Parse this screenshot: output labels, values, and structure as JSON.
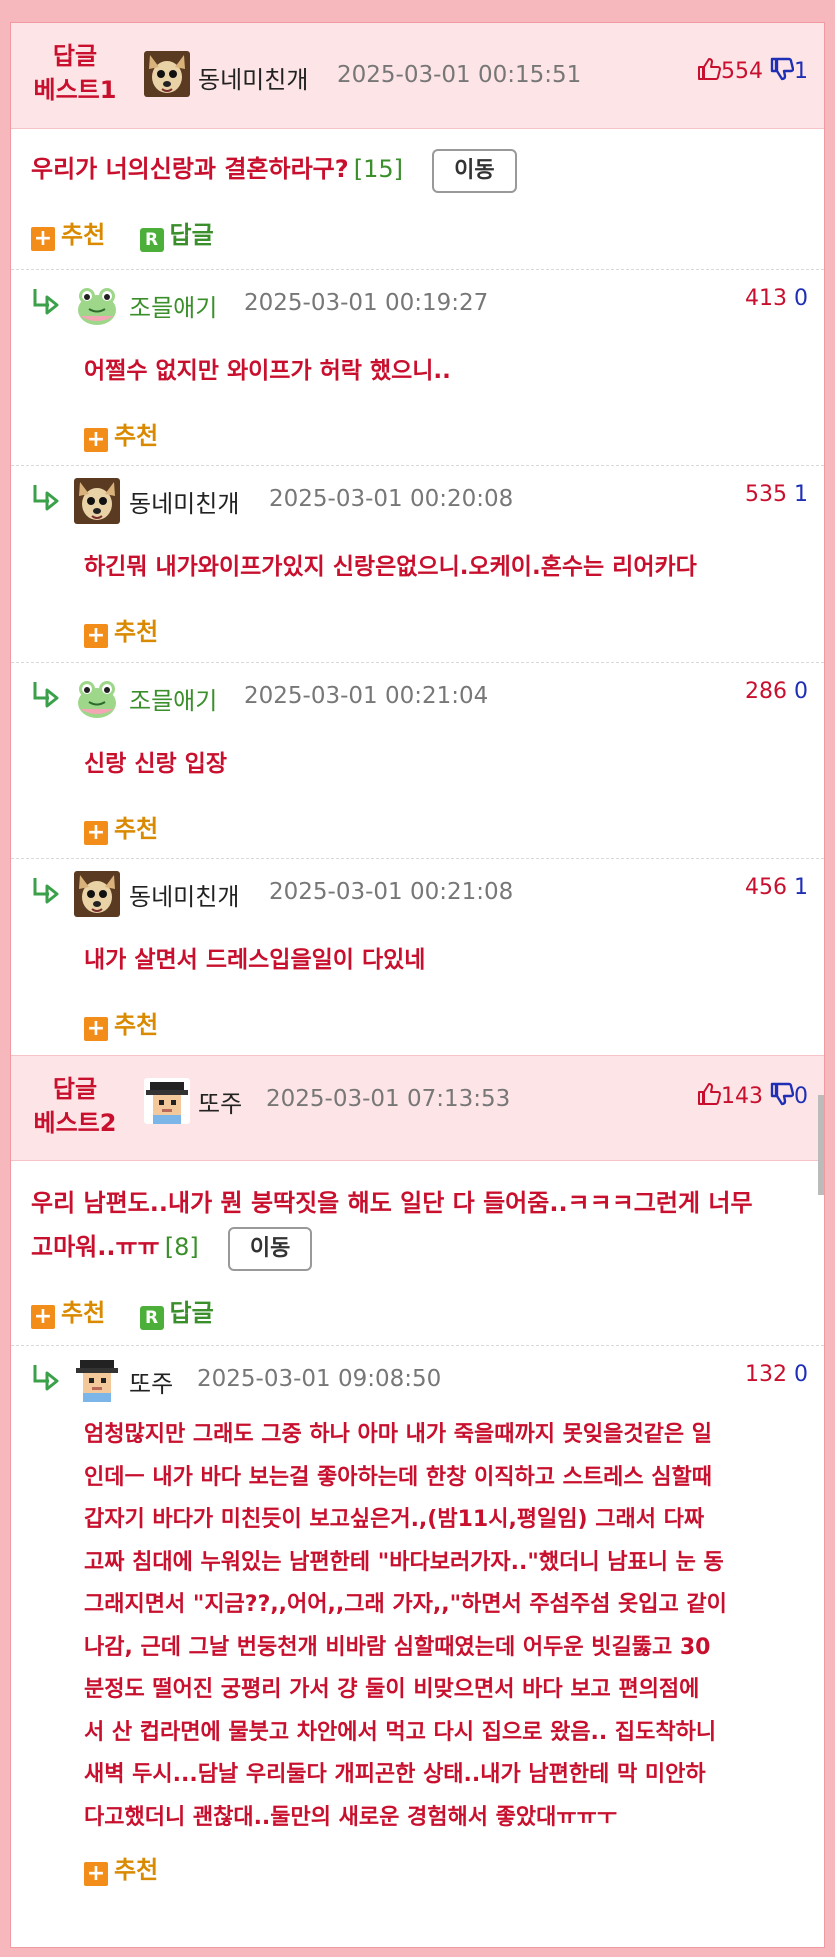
{
  "best": [
    {
      "label_line1": "답글",
      "label_line2": "베스트1",
      "nick": "동네미친개",
      "date": "2025-03-01 00:15:51",
      "up": "554",
      "down": "1",
      "title": "우리가 너의신랑과 결혼하라구?",
      "count": "[15]",
      "move": "이동",
      "recommend": "추천",
      "reply": "답글",
      "replies": [
        {
          "nick": "조믈애기",
          "date": "2025-03-01 00:19:27",
          "up": "413",
          "down": "0",
          "text": "어쩔수 없지만 와이프가 허락 했으니..",
          "recommend": "추천"
        },
        {
          "nick": "동네미친개",
          "date": "2025-03-01 00:20:08",
          "up": "535",
          "down": "1",
          "text": "하긴뭐 내가와이프가있지 신랑은없으니.오케이.혼수는 리어카다",
          "recommend": "추천"
        },
        {
          "nick": "조믈애기",
          "date": "2025-03-01 00:21:04",
          "up": "286",
          "down": "0",
          "text": "신랑 신랑 입장",
          "recommend": "추천"
        },
        {
          "nick": "동네미친개",
          "date": "2025-03-01 00:21:08",
          "up": "456",
          "down": "1",
          "text": "내가 살면서 드레스입을일이 다있네",
          "recommend": "추천"
        }
      ]
    },
    {
      "label_line1": "답글",
      "label_line2": "베스트2",
      "nick": "또주",
      "date": "2025-03-01 07:13:53",
      "up": "143",
      "down": "0",
      "title_line1": "우리 남편도..내가 뭔 붕딱짓을 해도 일단 다 들어줌..ㅋㅋㅋ그런게 너무",
      "title_line2": "고마워..ㅠㅠ",
      "count": "[8]",
      "move": "이동",
      "recommend": "추천",
      "reply": "답글",
      "replies": [
        {
          "nick": "또주",
          "date": "2025-03-01 09:08:50",
          "up": "132",
          "down": "0",
          "lines": [
            "엄청많지만 그래도 그중 하나 아마 내가 죽을때까지 못잊을것같은 일",
            "인데ㅡ 내가 바다 보는걸 좋아하는데 한창 이직하고 스트레스 심할때",
            "갑자기 바다가 미친듯이 보고싶은거.,(밤11시,평일임) 그래서 다짜",
            "고짜 침대에 누워있는 남편한테 \"바다보러가자..\"했더니 남표니 눈 동",
            "그래지면서 \"지금??,,어어,,그래 가자,,\"하면서 주섬주섬 옷입고 같이",
            "나감, 근데 그날 번둥천개 비바람 심할때였는데 어두운 빗길뚫고 30",
            "분정도 떨어진 궁평리 가서 걍 둘이 비맞으면서 바다 보고 편의점에",
            "서 산 컵라면에 물붓고 차안에서 먹고 다시 집으로 왔음.. 집도착하니",
            "새벽 두시...담날 우리둘다 개피곤한 상태..내가 남편한테 막 미안하",
            "다고했더니 괜찮대..둘만의 새로운 경험해서 좋았대ㅠㅠㅜ"
          ],
          "recommend": "추천"
        }
      ]
    }
  ]
}
